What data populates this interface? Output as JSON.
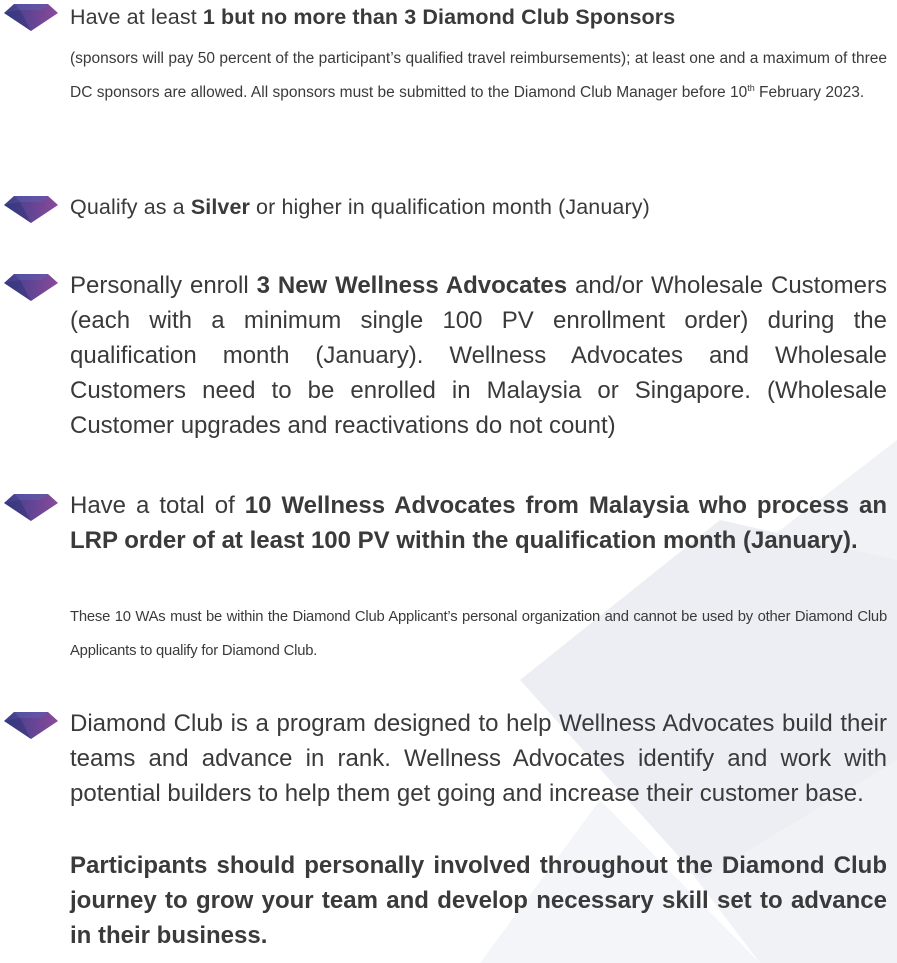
{
  "colors": {
    "text": "#3a3a3a",
    "diamond_left": "#3b3f8c",
    "diamond_right": "#8a4a9a",
    "background_shape": "#eef0f4"
  },
  "items": [
    {
      "icon": "diamond-bullet-icon",
      "head_pre": "Have at least ",
      "head_bold": "1 but no more than 3 Diamond Club Sponsors",
      "detail_pre": "(sponsors will pay 50 percent of the participant’s qualified travel reimbursements); at least one and a maximum of three DC sponsors are allowed. All sponsors must be submitted to the Diamond Club Manager before 10",
      "detail_sup": "th",
      "detail_post": " February 2023."
    },
    {
      "icon": "diamond-bullet-icon",
      "pre": "Qualify as a ",
      "bold": "Silver",
      "post": " or higher in qualification month (January)"
    },
    {
      "icon": "diamond-bullet-icon",
      "pre": "Personally enroll ",
      "bold": "3 New Wellness Advocates",
      "post": " and/or Wholesale Customers (each with a minimum single 100 PV enrollment order) during the qualification month (January). Wellness Advocates and Wholesale Customers need to be enrolled in Malaysia or Singapore. (Wholesale Customer upgrades and reactivations do not count)"
    },
    {
      "icon": "diamond-bullet-icon",
      "pre": "Have a total of ",
      "bold": "10 Wellness Advocates from Malaysia who process an LRP order of  at least 100 PV within the qualification month (January).",
      "detail": "These 10 WAs must be within the Diamond Club Applicant’s personal organization and cannot be used by other Diamond Club Applicants to qualify for Diamond Club."
    },
    {
      "icon": "diamond-bullet-icon",
      "text": "Diamond Club is a program designed to help Wellness Advocates build their teams and advance in rank. Wellness Advocates identify and work with potential builders to help them get going and increase their customer base.",
      "bold": "Participants should personally involved throughout the Diamond Club journey to grow your team and develop necessary skill set to advance in their business."
    }
  ]
}
